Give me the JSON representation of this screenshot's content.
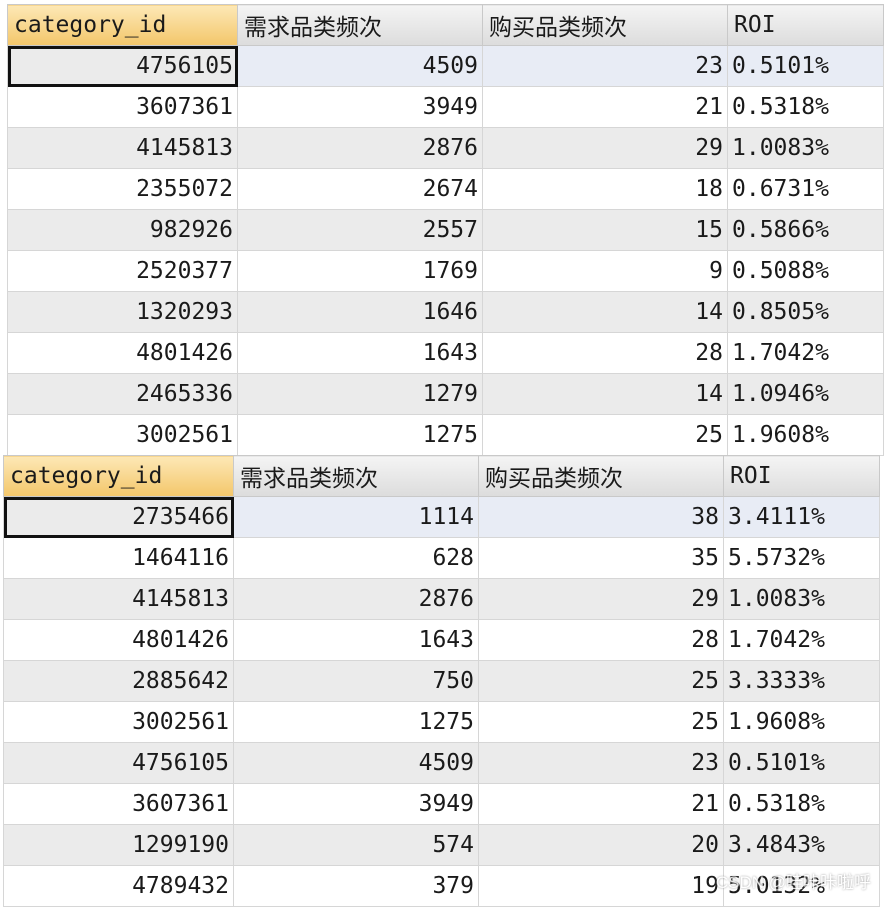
{
  "columns": [
    "category_id",
    "需求品类频次",
    "购买品类频次",
    "ROI"
  ],
  "table_top": {
    "rows": [
      [
        "4756105",
        "4509",
        "23",
        "0.5101%"
      ],
      [
        "3607361",
        "3949",
        "21",
        "0.5318%"
      ],
      [
        "4145813",
        "2876",
        "29",
        "1.0083%"
      ],
      [
        "2355072",
        "2674",
        "18",
        "0.6731%"
      ],
      [
        "982926",
        "2557",
        "15",
        "0.5866%"
      ],
      [
        "2520377",
        "1769",
        "9",
        "0.5088%"
      ],
      [
        "1320293",
        "1646",
        "14",
        "0.8505%"
      ],
      [
        "4801426",
        "1643",
        "28",
        "1.7042%"
      ],
      [
        "2465336",
        "1279",
        "14",
        "1.0946%"
      ],
      [
        "3002561",
        "1275",
        "25",
        "1.9608%"
      ]
    ]
  },
  "table_bottom": {
    "rows": [
      [
        "2735466",
        "1114",
        "38",
        "3.4111%"
      ],
      [
        "1464116",
        "628",
        "35",
        "5.5732%"
      ],
      [
        "4145813",
        "2876",
        "29",
        "1.0083%"
      ],
      [
        "4801426",
        "1643",
        "28",
        "1.7042%"
      ],
      [
        "2885642",
        "750",
        "25",
        "3.3333%"
      ],
      [
        "3002561",
        "1275",
        "25",
        "1.9608%"
      ],
      [
        "4756105",
        "4509",
        "23",
        "0.5101%"
      ],
      [
        "3607361",
        "3949",
        "21",
        "0.5318%"
      ],
      [
        "1299190",
        "574",
        "20",
        "3.4843%"
      ],
      [
        "4789432",
        "379",
        "19",
        "5.0132%"
      ]
    ]
  },
  "watermark": "CSDN @哇咔咔啦呼"
}
